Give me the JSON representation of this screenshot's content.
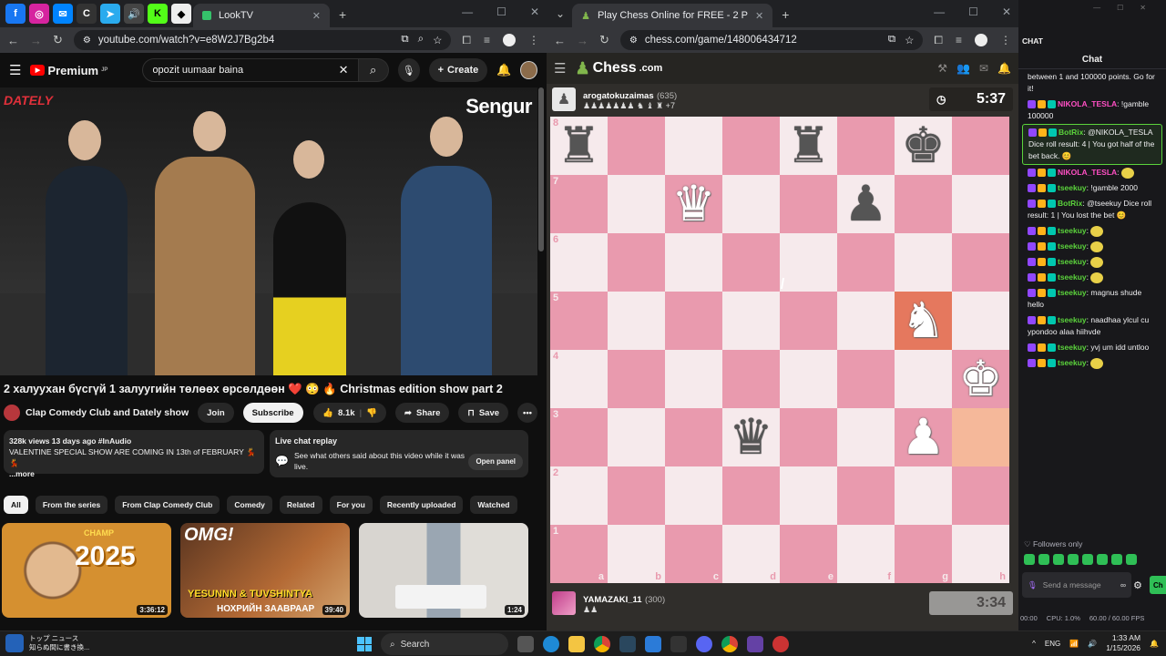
{
  "yt_browser": {
    "tabs": [
      "f",
      "ig",
      "m",
      "C",
      "✈",
      "🔊",
      "K",
      "◆"
    ],
    "active_tab": "LookTV",
    "url": "youtube.com/watch?v=e8W2J7Bg2b4"
  },
  "youtube": {
    "logo": "Premium",
    "logo_sup": "JP",
    "search_value": "opozit uumaar baina",
    "create_label": "Create",
    "video_overlay_brand": "Sengur",
    "video_overlay_left": "DATELY",
    "title": "2 халуухан бүсгүй 1 залуугийн төлөөх өрсөлдөөн ❤️ 😳 🔥 Christmas edition show part 2",
    "channel": "Clap Comedy Club and Dately show",
    "join_label": "Join",
    "subscribe_label": "Subscribe",
    "likes": "8.1k",
    "share_label": "Share",
    "save_label": "Save",
    "views_line": "328k views  13 days ago  #InAudio",
    "desc_line": "VALENTINE SPECIAL SHOW ARE COMING IN 13th of FEBRUARY 💃💃",
    "more_label": "...more",
    "live_title": "Live chat replay",
    "live_desc": "See what others said about this video while it was live.",
    "open_panel": "Open panel",
    "chips": [
      "All",
      "From the series",
      "From Clap Comedy Club",
      "Comedy",
      "Related",
      "For you",
      "Recently uploaded",
      "Watched"
    ],
    "thumbs": [
      {
        "year": "2025",
        "top": "CHAMP",
        "duration": "3:36:12"
      },
      {
        "omg": "OMG!",
        "names": "YESUNNN & TUVSHINTYA",
        "sub": "НОХРИЙН ЗААВРААР",
        "duration": "39:40"
      },
      {
        "duration": "1:24"
      }
    ]
  },
  "chess_browser": {
    "active_tab": "Play Chess Online for FREE - 2 P",
    "url": "chess.com/game/148006434712"
  },
  "chess": {
    "logo": "Chess",
    "logo_suffix": ".com",
    "opponent": {
      "name": "arogatokuzaimas",
      "rating": "(635)",
      "captured": "♟♟♟♟♟♟♟ ♞ ♝ ♜ +7",
      "clock": "5:37"
    },
    "player": {
      "name": "YAMAZAKI_11",
      "rating": "(300)",
      "captured": "♟♟",
      "clock": "3:34"
    },
    "board": [
      [
        "bR",
        "",
        "",
        "",
        "bR",
        "",
        "bK",
        ""
      ],
      [
        "",
        "",
        "wQ",
        "",
        "",
        "bP",
        "",
        ""
      ],
      [
        "",
        "",
        "",
        "",
        "",
        "",
        "",
        ""
      ],
      [
        "",
        "",
        "",
        "",
        "",
        "",
        "wN",
        ""
      ],
      [
        "",
        "",
        "",
        "",
        "",
        "",
        "",
        "wK"
      ],
      [
        "",
        "",
        "",
        "bQ",
        "",
        "",
        "wP",
        ""
      ],
      [
        "",
        "",
        "",
        "",
        "",
        "",
        "",
        ""
      ],
      [
        "",
        "",
        "",
        "",
        "",
        "",
        "",
        ""
      ]
    ],
    "highlights": {
      "g5": "hl",
      "h3": "hl2"
    },
    "files": [
      "a",
      "b",
      "c",
      "d",
      "e",
      "f",
      "g",
      "h"
    ],
    "ranks": [
      "8",
      "7",
      "6",
      "5",
      "4",
      "3",
      "2",
      "1"
    ]
  },
  "chat": {
    "header_left": "CHAT",
    "title": "Chat",
    "messages": [
      {
        "user": "",
        "text": "between 1 and 100000 points. Go for it!",
        "color": "#efeff1"
      },
      {
        "user": "NIKOLA_TESLA",
        "text": "!gamble 100000",
        "color": "#ff4fc4"
      },
      {
        "user": "BotRix",
        "text": "@NIKOLA_TESLA Dice roll result: 4 | You got half of the bet back. 😊",
        "color": "#5bd33c",
        "box": true
      },
      {
        "user": "NIKOLA_TESLA",
        "text": "",
        "color": "#ff4fc4"
      },
      {
        "user": "tseekuy",
        "text": "!gamble 2000",
        "color": "#5bd33c"
      },
      {
        "user": "BotRix",
        "text": "@tseekuy Dice roll result: 1 | You lost the bet 😊",
        "color": "#5bd33c"
      },
      {
        "user": "tseekuy",
        "text": "",
        "color": "#5bd33c"
      },
      {
        "user": "tseekuy",
        "text": "",
        "color": "#5bd33c"
      },
      {
        "user": "tseekuy",
        "text": "",
        "color": "#5bd33c"
      },
      {
        "user": "tseekuy",
        "text": "",
        "color": "#5bd33c"
      },
      {
        "user": "tseekuy",
        "text": "magnus shude hello",
        "color": "#5bd33c"
      },
      {
        "user": "tseekuy",
        "text": "naadhaa ylcul cu ypondoo alaa hiihvde",
        "color": "#5bd33c"
      },
      {
        "user": "tseekuy",
        "text": "yvj um idd untloo",
        "color": "#5bd33c"
      },
      {
        "user": "tseekuy",
        "text": "",
        "color": "#5bd33c"
      }
    ],
    "followers_only": "Followers only",
    "input_placeholder": "Send a message",
    "send_label": "Ch",
    "stats": [
      "00:00",
      "CPU: 1.0%",
      "60.00 / 60.00 FPS"
    ]
  },
  "taskbar": {
    "news_title": "トップ ニュース",
    "news_sub": "知らぬ間に書き換...",
    "search_label": "Search",
    "lang": "ENG",
    "time": "1:33 AM",
    "date": "1/15/2026"
  }
}
